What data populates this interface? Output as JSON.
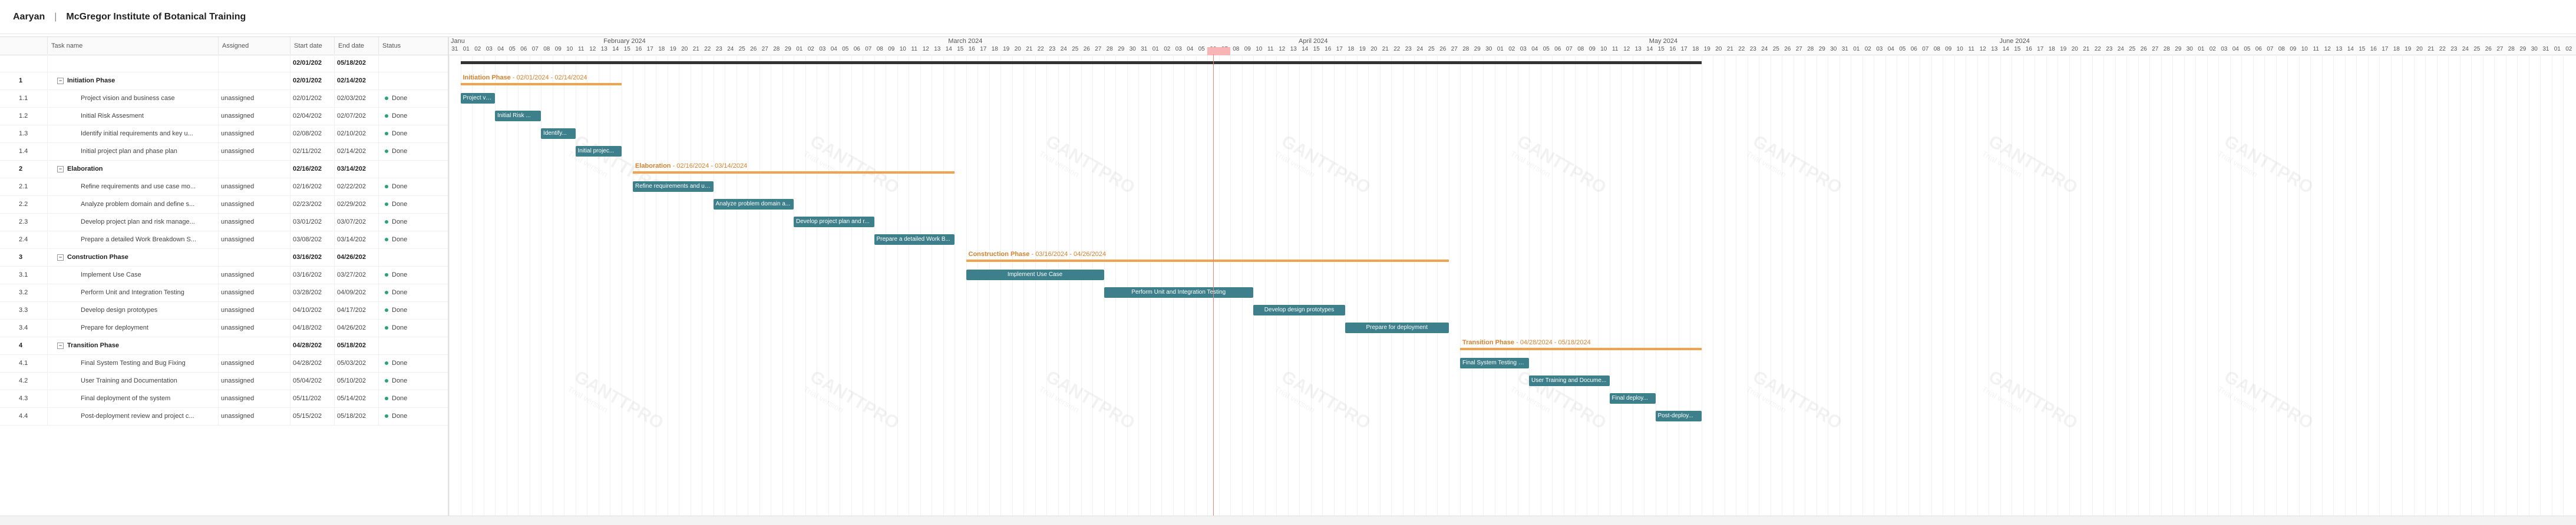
{
  "header": {
    "user": "Aaryan",
    "separator": "|",
    "project": "McGregor Institute of Botanical Training"
  },
  "grid": {
    "columns": {
      "task_name": "Task name",
      "assigned": "Assigned",
      "start": "Start date",
      "end": "End date",
      "status": "Status"
    },
    "rows": [
      {
        "wbs": "",
        "name": "",
        "assigned": "",
        "start": "02/01/202",
        "end": "05/18/202",
        "status": "",
        "phase": true,
        "toggle": ""
      },
      {
        "wbs": "1",
        "name": "Initiation Phase",
        "assigned": "",
        "start": "02/01/202",
        "end": "02/14/202",
        "status": "",
        "phase": true,
        "toggle": "−"
      },
      {
        "wbs": "1.1",
        "name": "Project vision and business case",
        "assigned": "unassigned",
        "start": "02/01/202",
        "end": "02/03/202",
        "status": "Done"
      },
      {
        "wbs": "1.2",
        "name": "Initial Risk Assesment",
        "assigned": "unassigned",
        "start": "02/04/202",
        "end": "02/07/202",
        "status": "Done"
      },
      {
        "wbs": "1.3",
        "name": "Identify initial requirements and key u...",
        "assigned": "unassigned",
        "start": "02/08/202",
        "end": "02/10/202",
        "status": "Done"
      },
      {
        "wbs": "1.4",
        "name": "Initial project plan and phase plan",
        "assigned": "unassigned",
        "start": "02/11/202",
        "end": "02/14/202",
        "status": "Done"
      },
      {
        "wbs": "2",
        "name": "Elaboration",
        "assigned": "",
        "start": "02/16/202",
        "end": "03/14/202",
        "status": "",
        "phase": true,
        "toggle": "−"
      },
      {
        "wbs": "2.1",
        "name": "Refine requirements and use case mo...",
        "assigned": "unassigned",
        "start": "02/16/202",
        "end": "02/22/202",
        "status": "Done"
      },
      {
        "wbs": "2.2",
        "name": "Analyze problem domain and define s...",
        "assigned": "unassigned",
        "start": "02/23/202",
        "end": "02/29/202",
        "status": "Done"
      },
      {
        "wbs": "2.3",
        "name": "Develop project plan and risk manage...",
        "assigned": "unassigned",
        "start": "03/01/202",
        "end": "03/07/202",
        "status": "Done"
      },
      {
        "wbs": "2.4",
        "name": "Prepare a detailed Work Breakdown S...",
        "assigned": "unassigned",
        "start": "03/08/202",
        "end": "03/14/202",
        "status": "Done"
      },
      {
        "wbs": "3",
        "name": "Construction Phase",
        "assigned": "",
        "start": "03/16/202",
        "end": "04/26/202",
        "status": "",
        "phase": true,
        "toggle": "−"
      },
      {
        "wbs": "3.1",
        "name": "Implement Use Case",
        "assigned": "unassigned",
        "start": "03/16/202",
        "end": "03/27/202",
        "status": "Done"
      },
      {
        "wbs": "3.2",
        "name": "Perform Unit and Integration Testing",
        "assigned": "unassigned",
        "start": "03/28/202",
        "end": "04/09/202",
        "status": "Done"
      },
      {
        "wbs": "3.3",
        "name": "Develop design prototypes",
        "assigned": "unassigned",
        "start": "04/10/202",
        "end": "04/17/202",
        "status": "Done"
      },
      {
        "wbs": "3.4",
        "name": "Prepare for deployment",
        "assigned": "unassigned",
        "start": "04/18/202",
        "end": "04/26/202",
        "status": "Done"
      },
      {
        "wbs": "4",
        "name": "Transition Phase",
        "assigned": "",
        "start": "04/28/202",
        "end": "05/18/202",
        "status": "",
        "phase": true,
        "toggle": "−"
      },
      {
        "wbs": "4.1",
        "name": "Final System Testing and Bug Fixing",
        "assigned": "unassigned",
        "start": "04/28/202",
        "end": "05/03/202",
        "status": "Done"
      },
      {
        "wbs": "4.2",
        "name": "User Training and Documentation",
        "assigned": "unassigned",
        "start": "05/04/202",
        "end": "05/10/202",
        "status": "Done"
      },
      {
        "wbs": "4.3",
        "name": "Final deployment of the system",
        "assigned": "unassigned",
        "start": "05/11/202",
        "end": "05/14/202",
        "status": "Done"
      },
      {
        "wbs": "4.4",
        "name": "Post-deployment review and project c...",
        "assigned": "unassigned",
        "start": "05/15/202",
        "end": "05/18/202",
        "status": "Done"
      }
    ]
  },
  "timeline": {
    "months": [
      {
        "label": "Janu"
      },
      {
        "label": "February 2024"
      },
      {
        "label": "March 2024"
      },
      {
        "label": "April 2024"
      },
      {
        "label": "May 2024"
      },
      {
        "label": "June 2024"
      }
    ],
    "start_date": "2024-01-31",
    "day_count": 185,
    "today": "2024-04-06",
    "project_bar": {
      "start": "2024-02-01",
      "end": "2024-05-18"
    },
    "phases": [
      {
        "title": "Initiation Phase",
        "dates": "02/01/2024 - 02/14/2024",
        "start": "2024-02-01",
        "end": "2024-02-14",
        "row": 1
      },
      {
        "title": "Elaboration",
        "dates": "02/16/2024 - 03/14/2024",
        "start": "2024-02-16",
        "end": "2024-03-14",
        "row": 6
      },
      {
        "title": "Construction Phase",
        "dates": "03/16/2024 - 04/26/2024",
        "start": "2024-03-16",
        "end": "2024-04-26",
        "row": 11
      },
      {
        "title": "Transition Phase",
        "dates": "04/28/2024 - 05/18/2024",
        "start": "2024-04-28",
        "end": "2024-05-18",
        "row": 16
      }
    ],
    "tasks": [
      {
        "label": "Project vis...",
        "start": "2024-02-01",
        "end": "2024-02-03",
        "row": 2
      },
      {
        "label": "Initial Risk ...",
        "start": "2024-02-04",
        "end": "2024-02-07",
        "row": 3
      },
      {
        "label": "Identify...",
        "start": "2024-02-08",
        "end": "2024-02-10",
        "row": 4
      },
      {
        "label": "Initial projec...",
        "start": "2024-02-11",
        "end": "2024-02-14",
        "row": 5
      },
      {
        "label": "Refine requirements and use ...",
        "start": "2024-02-16",
        "end": "2024-02-22",
        "row": 7
      },
      {
        "label": "Analyze problem domain a...",
        "start": "2024-02-23",
        "end": "2024-02-29",
        "row": 8
      },
      {
        "label": "Develop project plan and r...",
        "start": "2024-03-01",
        "end": "2024-03-07",
        "row": 9
      },
      {
        "label": "Prepare a detailed Work B...",
        "start": "2024-03-08",
        "end": "2024-03-14",
        "row": 10
      },
      {
        "label": "Implement Use Case",
        "start": "2024-03-16",
        "end": "2024-03-27",
        "row": 12,
        "center": true
      },
      {
        "label": "Perform Unit and Integration Testing",
        "start": "2024-03-28",
        "end": "2024-04-09",
        "row": 13,
        "center": true
      },
      {
        "label": "Develop design prototypes",
        "start": "2024-04-10",
        "end": "2024-04-17",
        "row": 14,
        "center": true
      },
      {
        "label": "Prepare for deployment",
        "start": "2024-04-18",
        "end": "2024-04-26",
        "row": 15,
        "center": true
      },
      {
        "label": "Final System Testing and...",
        "start": "2024-04-28",
        "end": "2024-05-03",
        "row": 17
      },
      {
        "label": "User Training and Docume...",
        "start": "2024-05-04",
        "end": "2024-05-10",
        "row": 18
      },
      {
        "label": "Final deploy...",
        "start": "2024-05-11",
        "end": "2024-05-14",
        "row": 19
      },
      {
        "label": "Post-deploy...",
        "start": "2024-05-15",
        "end": "2024-05-18",
        "row": 20
      }
    ],
    "watermark": {
      "brand": "GANTTPRO",
      "sub": "Trial version"
    }
  },
  "colors": {
    "phase": "#f0a24c",
    "task": "#3d7f8a",
    "today": "#f08080",
    "done": "#2aa37a"
  }
}
